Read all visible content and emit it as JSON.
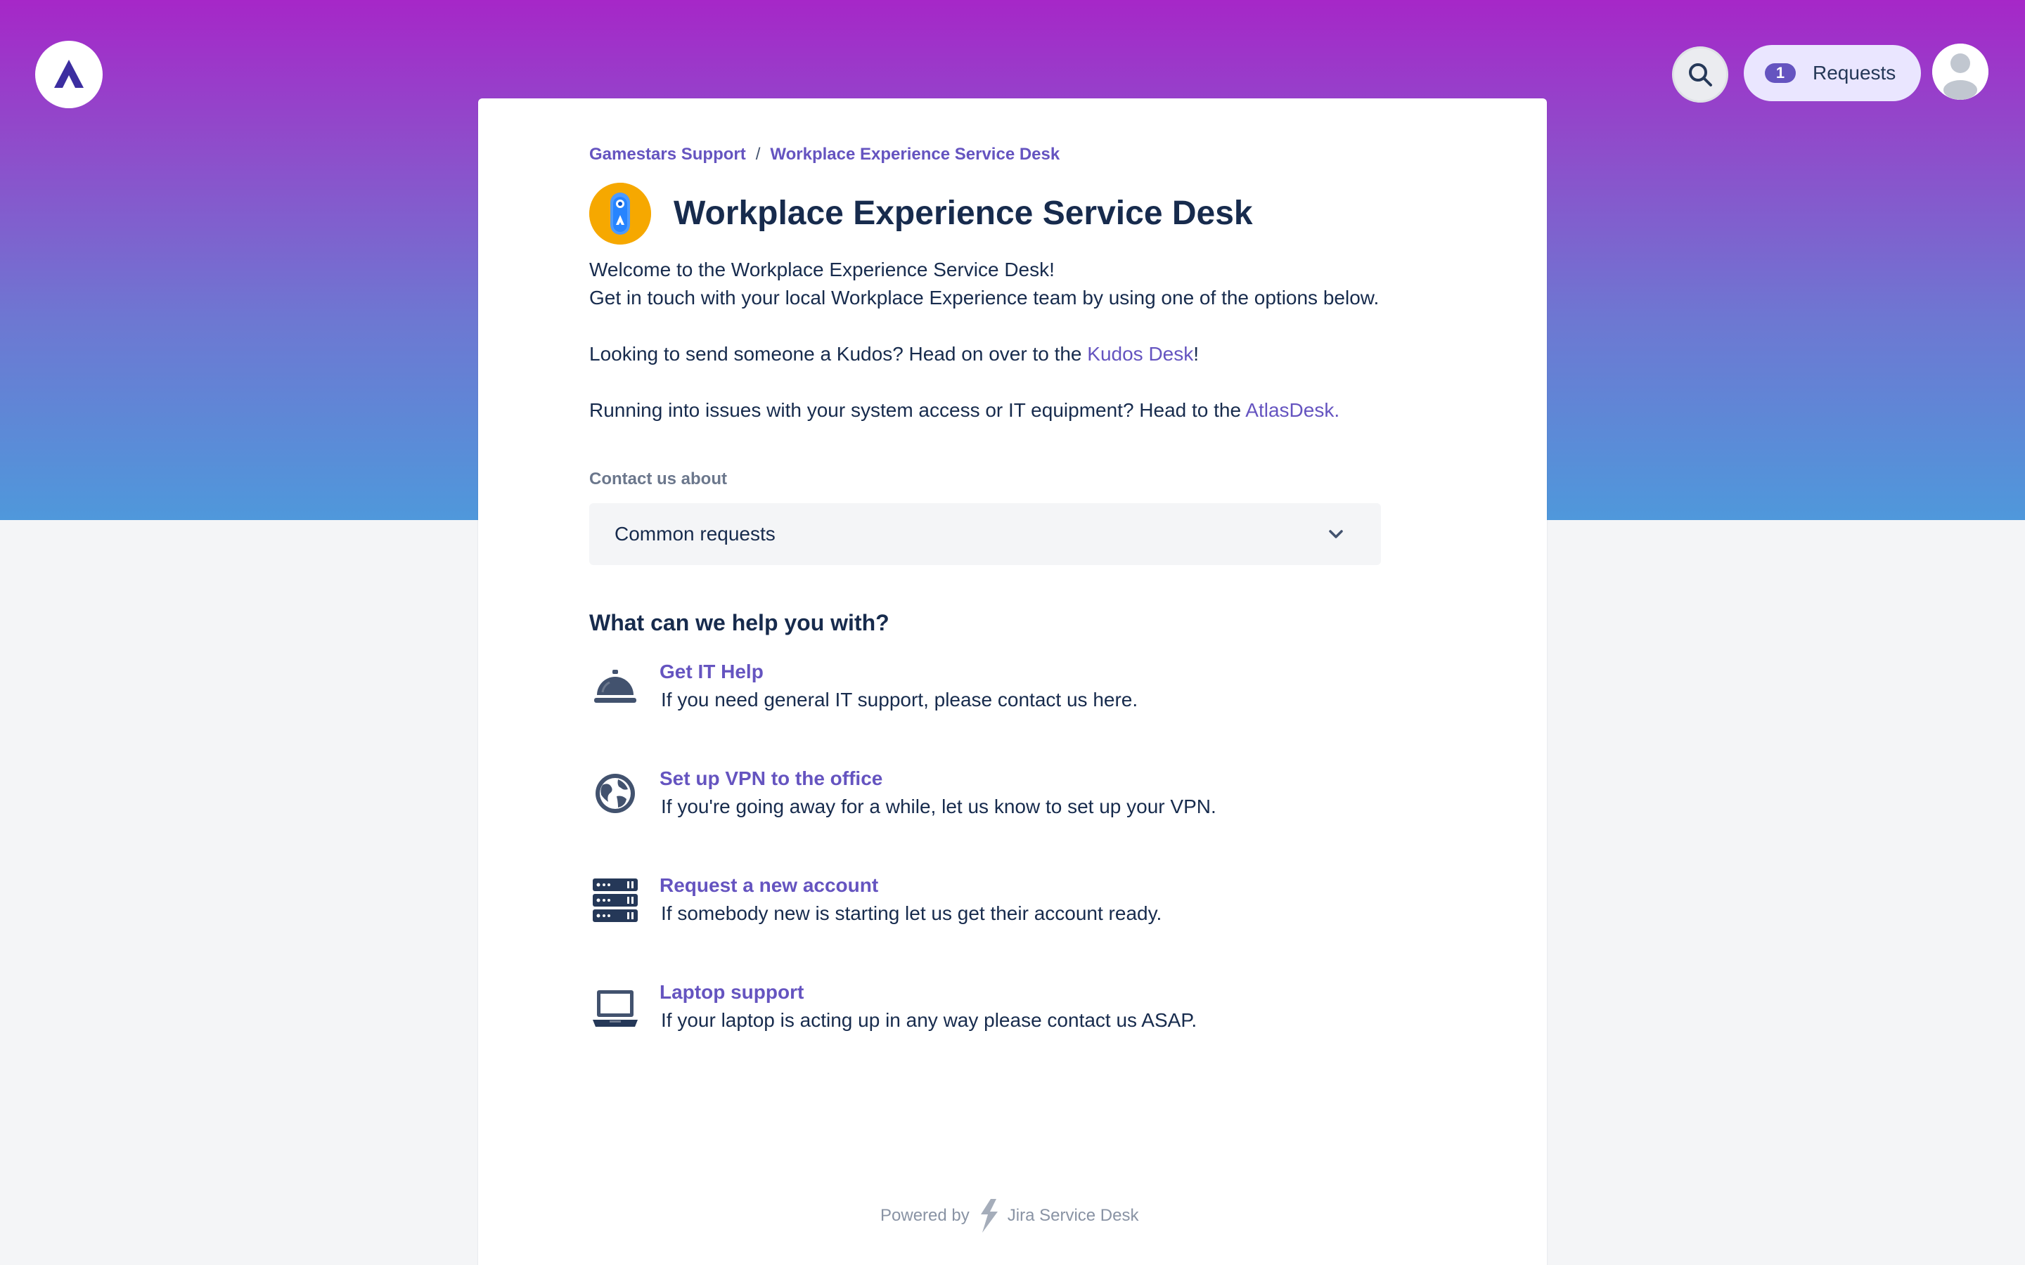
{
  "header": {
    "logo_icon": "atlassian-logo-icon",
    "search_icon": "search-icon",
    "requests": {
      "count": "1",
      "label": "Requests"
    },
    "avatar_icon": "user-avatar-icon"
  },
  "breadcrumb": {
    "items": [
      "Gamestars Support",
      "Workplace Experience Service Desk"
    ],
    "separator": "/"
  },
  "portal": {
    "title": "Workplace Experience Service Desk",
    "icon": "portal-rocket-icon",
    "description": {
      "line1": "Welcome to the Workplace Experience Service Desk!",
      "line2": "Get in touch with your local Workplace Experience team by using one of the options below.",
      "kudos_prefix": "Looking to send someone a Kudos? Head on over to the ",
      "kudos_link": "Kudos Desk",
      "kudos_suffix": "!",
      "it_prefix": "Running into issues with your system access or IT equipment? Head to the ",
      "it_link": "AtlasDesk."
    }
  },
  "contact": {
    "label": "Contact us about",
    "selected": "Common requests"
  },
  "help": {
    "heading": "What can we help you with?",
    "items": [
      {
        "title": "Get IT Help",
        "description": "If you need general IT support, please contact us here.",
        "icon": "service-bell-icon"
      },
      {
        "title": "Set up VPN to the office",
        "description": "If you're going away for a while, let us know to set up your VPN.",
        "icon": "globe-icon"
      },
      {
        "title": "Request a new account",
        "description": "If somebody new is starting let us get their account ready.",
        "icon": "server-icon"
      },
      {
        "title": "Laptop support",
        "description": "If your laptop is acting up in any way please contact us ASAP.",
        "icon": "laptop-icon"
      }
    ]
  },
  "footer": {
    "prefix": "Powered by",
    "product": "Jira Service Desk"
  },
  "colors": {
    "accent": "#6554c0",
    "text": "#172b4d",
    "banner_top": "#a627c8",
    "banner_bottom": "#4f98db"
  }
}
